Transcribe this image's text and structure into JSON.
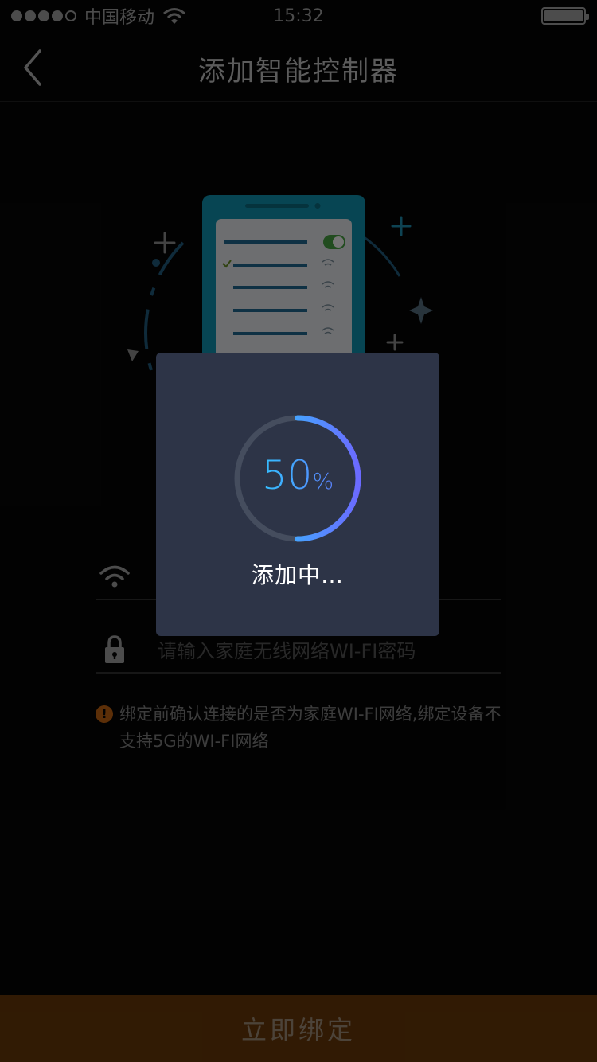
{
  "status_bar": {
    "carrier": "中国移动",
    "time": "15:32",
    "signal_bars_filled": 4,
    "signal_bars_total": 5
  },
  "nav": {
    "title": "添加智能控制器",
    "back_icon": "chevron-left-icon"
  },
  "form": {
    "wifi_icon": "wifi-icon",
    "password_icon": "lock-icon",
    "password_placeholder": "请输入家庭无线网络WI-FI密码"
  },
  "warning": {
    "icon": "alert-icon",
    "text": "绑定前确认连接的是否为家庭WI-FI网络,绑定设备不支持5G的WI-FI网络"
  },
  "bind_button": {
    "label": "立即绑定"
  },
  "dialog": {
    "progress_number": "50",
    "progress_unit": "%",
    "progress_fraction": 0.5,
    "label": "添加中…"
  },
  "colors": {
    "background": "#050505",
    "button_bg": "#5a3108",
    "dialog_bg": "#2d3447",
    "progress_start": "#23d8ff",
    "progress_end": "#6b6aff",
    "warning_icon": "#a8560f",
    "toggle_on": "#3d8a3a"
  }
}
